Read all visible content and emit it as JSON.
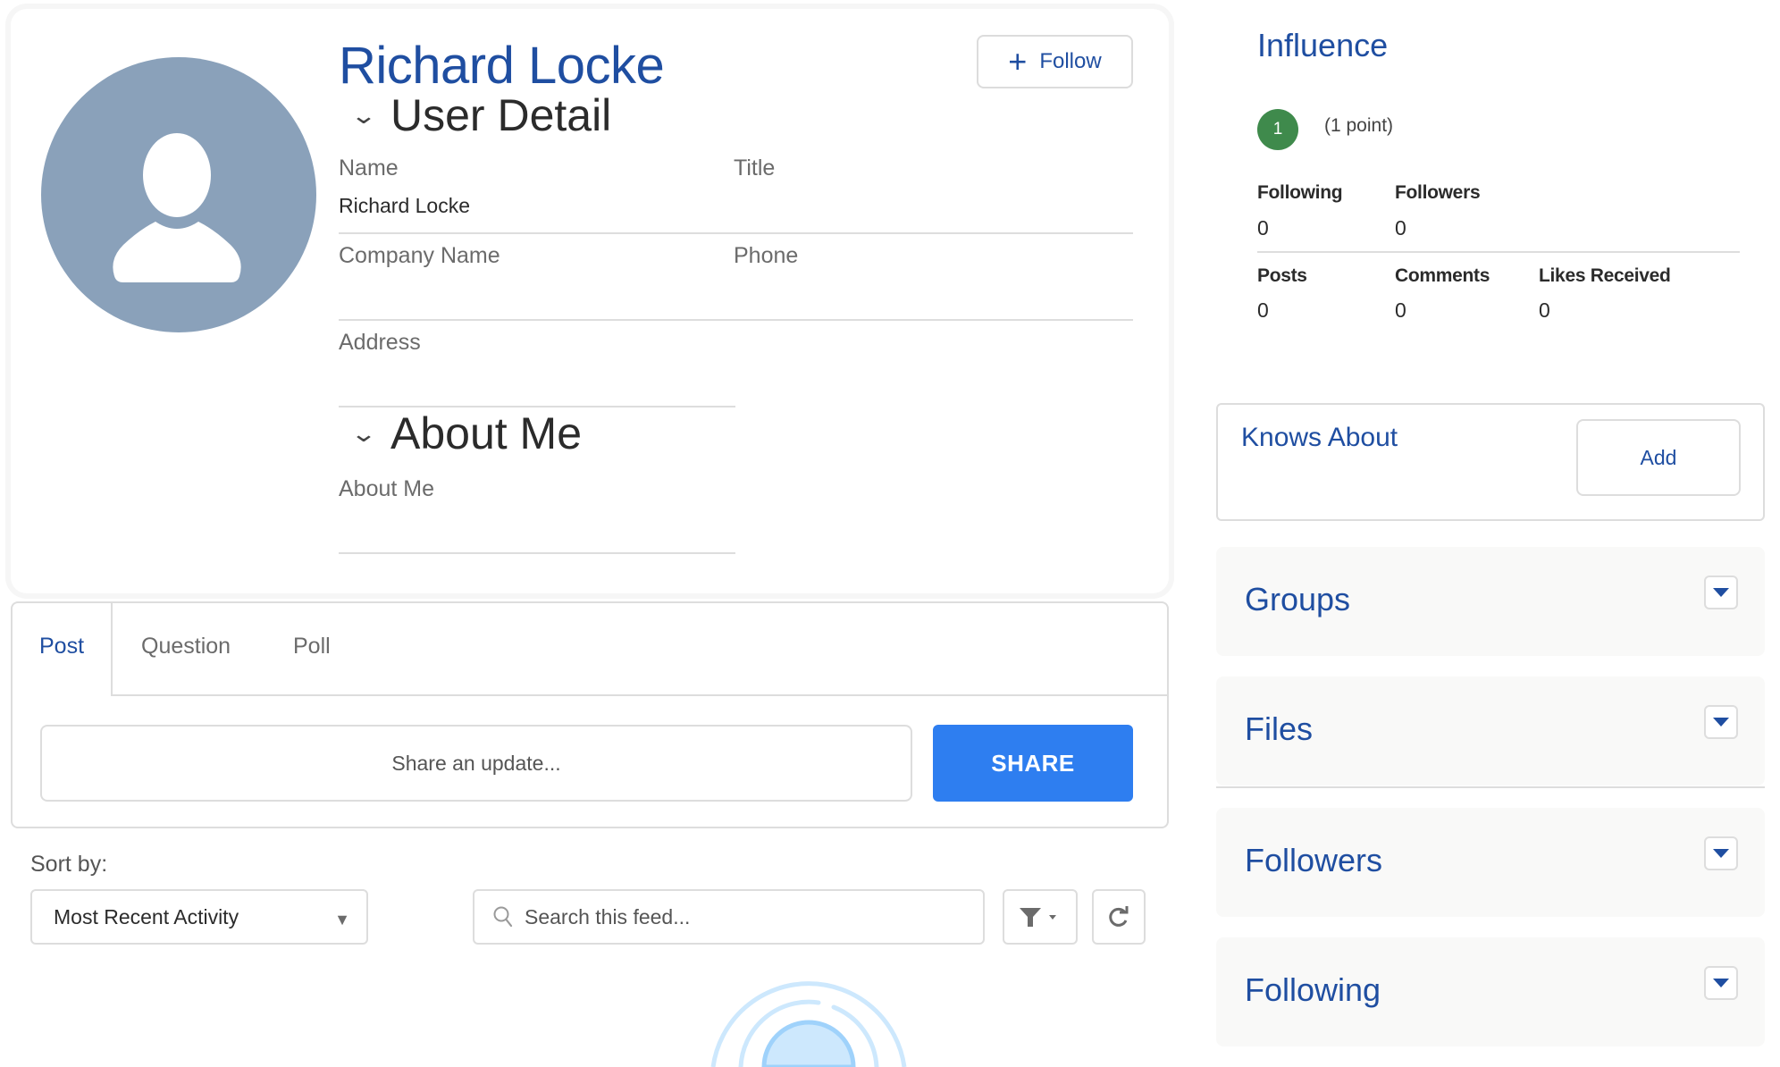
{
  "profile": {
    "name": "Richard Locke",
    "follow_label": "Follow",
    "user_detail": {
      "heading": "User Detail",
      "fields": {
        "name_label": "Name",
        "name_value": "Richard Locke",
        "title_label": "Title",
        "title_value": "",
        "company_label": "Company Name",
        "company_value": "",
        "phone_label": "Phone",
        "phone_value": "",
        "address_label": "Address",
        "address_value": ""
      }
    },
    "about_me": {
      "heading": "About Me",
      "field_label": "About Me",
      "field_value": ""
    }
  },
  "publisher": {
    "tabs": [
      {
        "label": "Post",
        "active": true
      },
      {
        "label": "Question",
        "active": false
      },
      {
        "label": "Poll",
        "active": false
      }
    ],
    "input_placeholder": "Share an update...",
    "share_label": "SHARE"
  },
  "feed": {
    "sort_label": "Sort by:",
    "sort_selected": "Most Recent Activity",
    "search_placeholder": "Search this feed..."
  },
  "influence": {
    "title": "Influence",
    "level": "1",
    "points_text": "(1 point)",
    "stats": {
      "following_label": "Following",
      "following_value": "0",
      "followers_label": "Followers",
      "followers_value": "0",
      "posts_label": "Posts",
      "posts_value": "0",
      "comments_label": "Comments",
      "comments_value": "0",
      "likes_label": "Likes Received",
      "likes_value": "0"
    }
  },
  "knows_about": {
    "title": "Knows About",
    "add_label": "Add"
  },
  "sidebar_cards": [
    {
      "title": "Groups"
    },
    {
      "title": "Files"
    },
    {
      "title": "Followers"
    },
    {
      "title": "Following"
    }
  ],
  "colors": {
    "brand_blue": "#1f4ea1",
    "share_button": "#2e7ef0",
    "avatar_bg": "#8aa1ba",
    "influence_badge": "#3f8a4c"
  }
}
